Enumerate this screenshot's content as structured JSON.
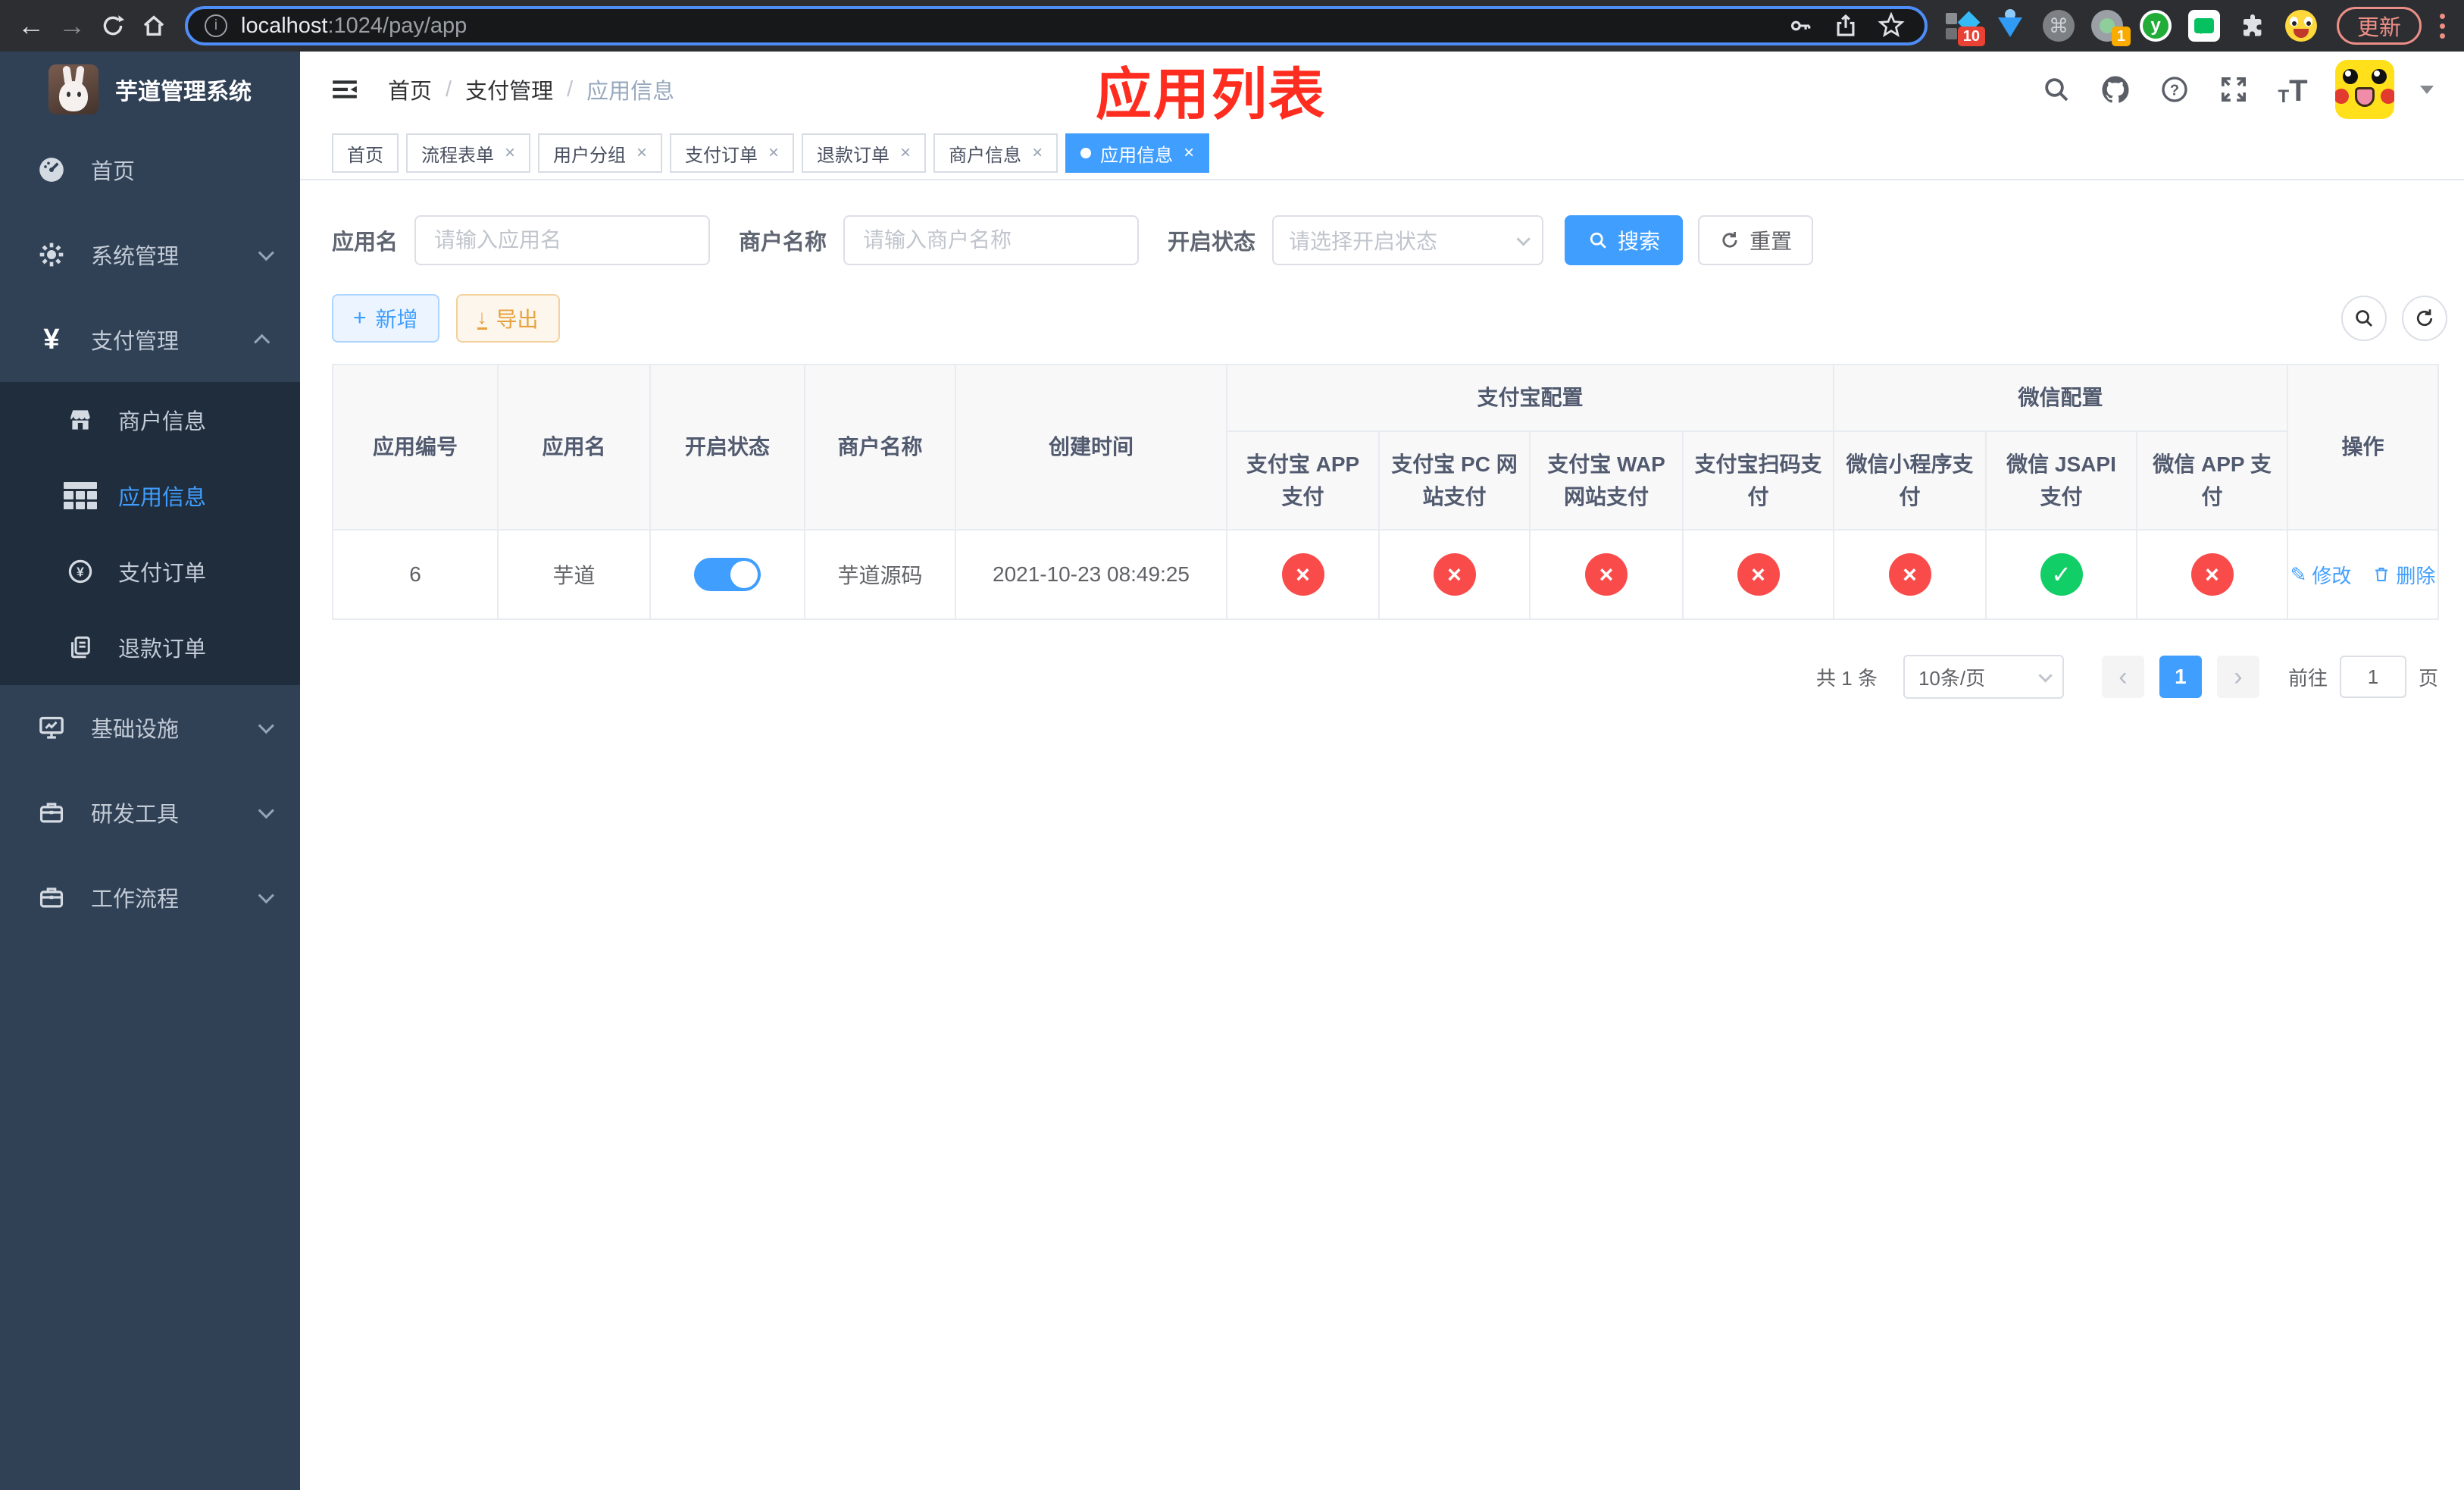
{
  "colors": {
    "accent": "#409eff",
    "success": "#12ce66",
    "danger": "#fa4b4b",
    "warning": "#e6a23c",
    "sidebar": "#304156",
    "annotation": "#ff2d1f"
  },
  "browser": {
    "url_host": "localhost",
    "url_rest": ":1024/pay/app",
    "update_button": "更新",
    "ext_badge_blue_diamond": "10",
    "ext_badge_status": "1"
  },
  "sidebar": {
    "logo_title": "芋道管理系统",
    "items": [
      {
        "label": "首页"
      },
      {
        "label": "系统管理"
      },
      {
        "label": "支付管理",
        "children": [
          {
            "label": "商户信息"
          },
          {
            "label": "应用信息"
          },
          {
            "label": "支付订单"
          },
          {
            "label": "退款订单"
          }
        ]
      },
      {
        "label": "基础设施"
      },
      {
        "label": "研发工具"
      },
      {
        "label": "工作流程"
      }
    ]
  },
  "navbar": {
    "breadcrumb": [
      {
        "label": "首页"
      },
      {
        "label": "支付管理"
      },
      {
        "label": "应用信息"
      }
    ],
    "annotation": "应用列表"
  },
  "tags": [
    {
      "label": "首页"
    },
    {
      "label": "流程表单"
    },
    {
      "label": "用户分组"
    },
    {
      "label": "支付订单"
    },
    {
      "label": "退款订单"
    },
    {
      "label": "商户信息"
    },
    {
      "label": "应用信息"
    }
  ],
  "filters": {
    "app_name_label": "应用名",
    "app_name_placeholder": "请输入应用名",
    "merchant_label": "商户名称",
    "merchant_placeholder": "请输入商户名称",
    "status_label": "开启状态",
    "status_placeholder": "请选择开启状态",
    "search_button": "搜索",
    "reset_button": "重置"
  },
  "toolbar": {
    "add_button": "新增",
    "export_button": "导出"
  },
  "table": {
    "columns": {
      "id": "应用编号",
      "name": "应用名",
      "enabled": "开启状态",
      "merchant": "商户名称",
      "created": "创建时间",
      "alipay_group": "支付宝配置",
      "wechat_group": "微信配置",
      "alipay_app": "支付宝 APP 支付",
      "alipay_pc": "支付宝 PC 网站支付",
      "alipay_wap": "支付宝 WAP 网站支付",
      "alipay_qr": "支付宝扫码支付",
      "wx_mini": "微信小程序支付",
      "wx_jsapi": "微信 JSAPI 支付",
      "wx_app": "微信 APP 支付",
      "actions": "操作"
    },
    "row": {
      "id": "6",
      "name": "芋道",
      "enabled": true,
      "merchant": "芋道源码",
      "created": "2021-10-23 08:49:25",
      "pay_channels": [
        "error",
        "error",
        "error",
        "error",
        "error",
        "success",
        "error"
      ],
      "edit_label": "修改",
      "delete_label": "删除"
    }
  },
  "pagination": {
    "total": "共 1 条",
    "page_size": "10条/页",
    "current_page": "1",
    "jump_prefix": "前往",
    "jump_value": "1",
    "jump_suffix": "页"
  }
}
